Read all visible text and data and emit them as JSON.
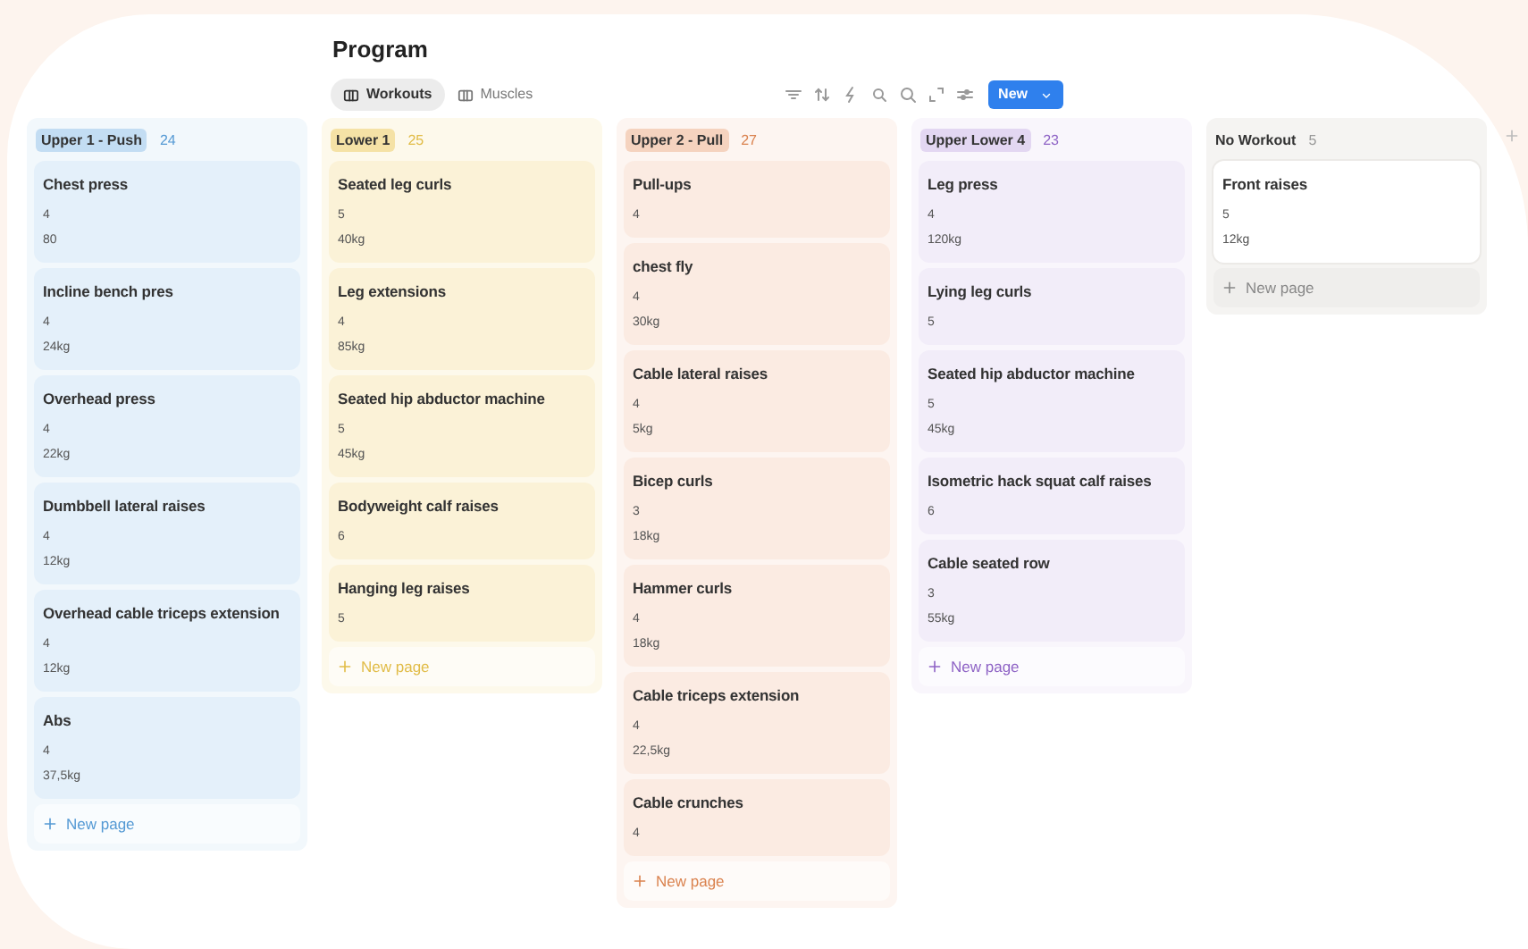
{
  "title": "Program",
  "views": [
    {
      "label": "Workouts",
      "selected": true
    },
    {
      "label": "Muscles",
      "selected": false
    }
  ],
  "toolbar": {
    "new_button": "New"
  },
  "groups": [
    {
      "name": "Upper 1 - Push",
      "count": "24",
      "kind": "tagged",
      "color": "#c3ddf3",
      "new_page": "New page",
      "cards": [
        {
          "title": "Chest press",
          "props": [
            "4",
            "80"
          ]
        },
        {
          "title": "Incline bench pres",
          "props": [
            "4",
            "24kg"
          ]
        },
        {
          "title": "Overhead press",
          "props": [
            "4",
            "22kg"
          ]
        },
        {
          "title": "Dumbbell lateral raises",
          "props": [
            "4",
            "12kg"
          ]
        },
        {
          "title": "Overhead cable triceps extension",
          "props": [
            "4",
            "12kg"
          ]
        },
        {
          "title": "Abs",
          "props": [
            "4",
            "37,5kg"
          ]
        }
      ]
    },
    {
      "name": "Lower 1",
      "count": "25",
      "kind": "tagged",
      "color": "#f5e2a6",
      "new_page": "New page",
      "cards": [
        {
          "title": "Seated leg curls",
          "props": [
            "5",
            "40kg"
          ]
        },
        {
          "title": "Leg extensions",
          "props": [
            "4",
            "85kg"
          ]
        },
        {
          "title": "Seated hip abductor machine",
          "props": [
            "5",
            "45kg"
          ]
        },
        {
          "title": "Bodyweight calf raises",
          "props": [
            "6"
          ]
        },
        {
          "title": "Hanging leg raises",
          "props": [
            "5"
          ]
        }
      ]
    },
    {
      "name": "Upper 2 - Pull",
      "count": "27",
      "kind": "tagged",
      "color": "#f5d3bf",
      "new_page": "New page",
      "cards": [
        {
          "title": "Pull-ups",
          "props": [
            "4"
          ]
        },
        {
          "title": "chest fly",
          "props": [
            "4",
            "30kg"
          ]
        },
        {
          "title": "Cable lateral raises",
          "props": [
            "4",
            "5kg"
          ]
        },
        {
          "title": "Bicep curls",
          "props": [
            "3",
            "18kg"
          ]
        },
        {
          "title": "Hammer curls",
          "props": [
            "4",
            "18kg"
          ]
        },
        {
          "title": "Cable triceps extension",
          "props": [
            "4",
            "22,5kg"
          ]
        },
        {
          "title": "Cable crunches",
          "props": [
            "4"
          ]
        }
      ]
    },
    {
      "name": "Upper Lower 4",
      "count": "23",
      "kind": "tagged",
      "color": "#e3d7f2",
      "new_page": "New page",
      "cards": [
        {
          "title": "Leg press",
          "props": [
            "4",
            "120kg"
          ]
        },
        {
          "title": "Lying leg curls",
          "props": [
            "5"
          ]
        },
        {
          "title": "Seated hip abductor machine",
          "props": [
            "5",
            "45kg"
          ]
        },
        {
          "title": "Isometric hack squat calf raises",
          "props": [
            "6"
          ]
        },
        {
          "title": "Cable seated row",
          "props": [
            "3",
            "55kg"
          ]
        }
      ]
    },
    {
      "name": "No Workout",
      "count": "5",
      "kind": "plain",
      "new_page": "New page",
      "cards": [
        {
          "title": "Front raises",
          "props": [
            "5",
            "12kg"
          ]
        }
      ]
    }
  ]
}
